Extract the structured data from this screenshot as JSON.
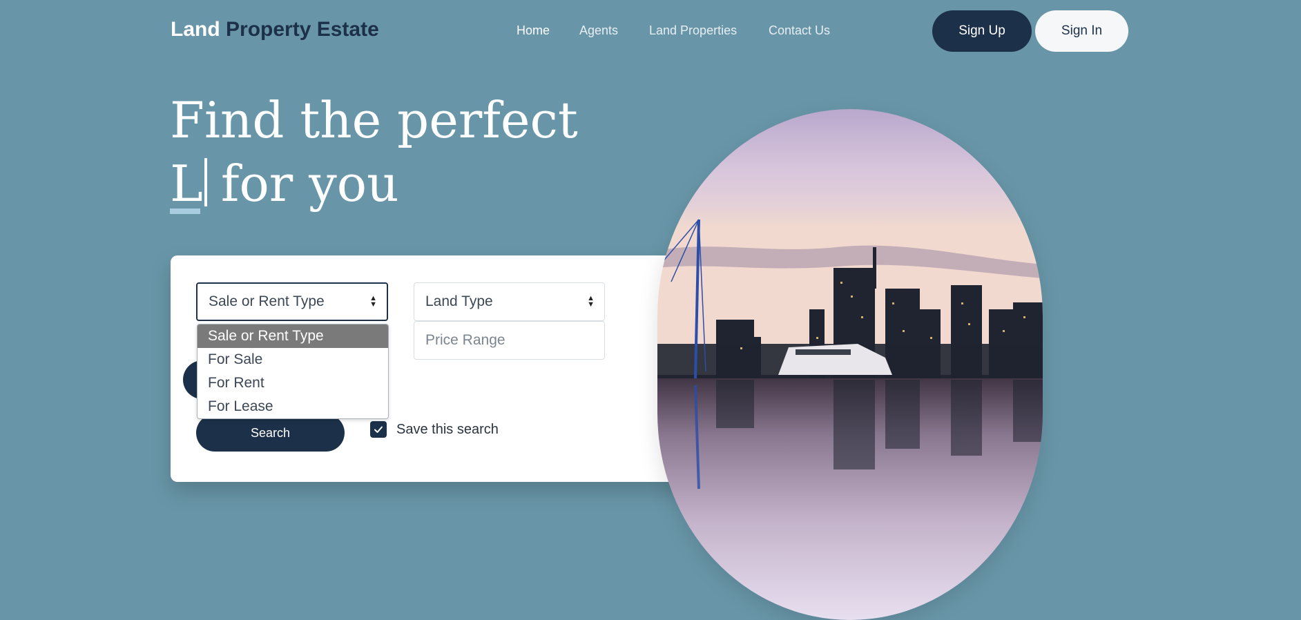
{
  "brand": {
    "part1": "Land",
    "part2": "Property Estate"
  },
  "nav": {
    "items": [
      "Home",
      "Agents",
      "Land Properties",
      "Contact Us"
    ],
    "active": "Home"
  },
  "auth": {
    "signup_label": "Sign Up",
    "signin_label": "Sign In"
  },
  "hero": {
    "line1": "Find the perfect",
    "typed_text": "L",
    "line2_rest": "for you"
  },
  "search": {
    "sale_rent_select": {
      "value": "Sale or Rent Type",
      "options": [
        "Sale or Rent Type",
        "For Sale",
        "For Rent",
        "For Lease"
      ]
    },
    "land_type_select": {
      "value": "Land Type"
    },
    "price_range_placeholder": "Price Range",
    "search_button_label": "Search",
    "save_search_label": "Save this search",
    "save_search_checked": true
  },
  "colors": {
    "background": "#6896a8",
    "primary": "#1c3149",
    "accent": "#a9cde0"
  },
  "icons": {
    "select_arrows": "sort-arrows-icon",
    "checkbox": "check-icon"
  }
}
